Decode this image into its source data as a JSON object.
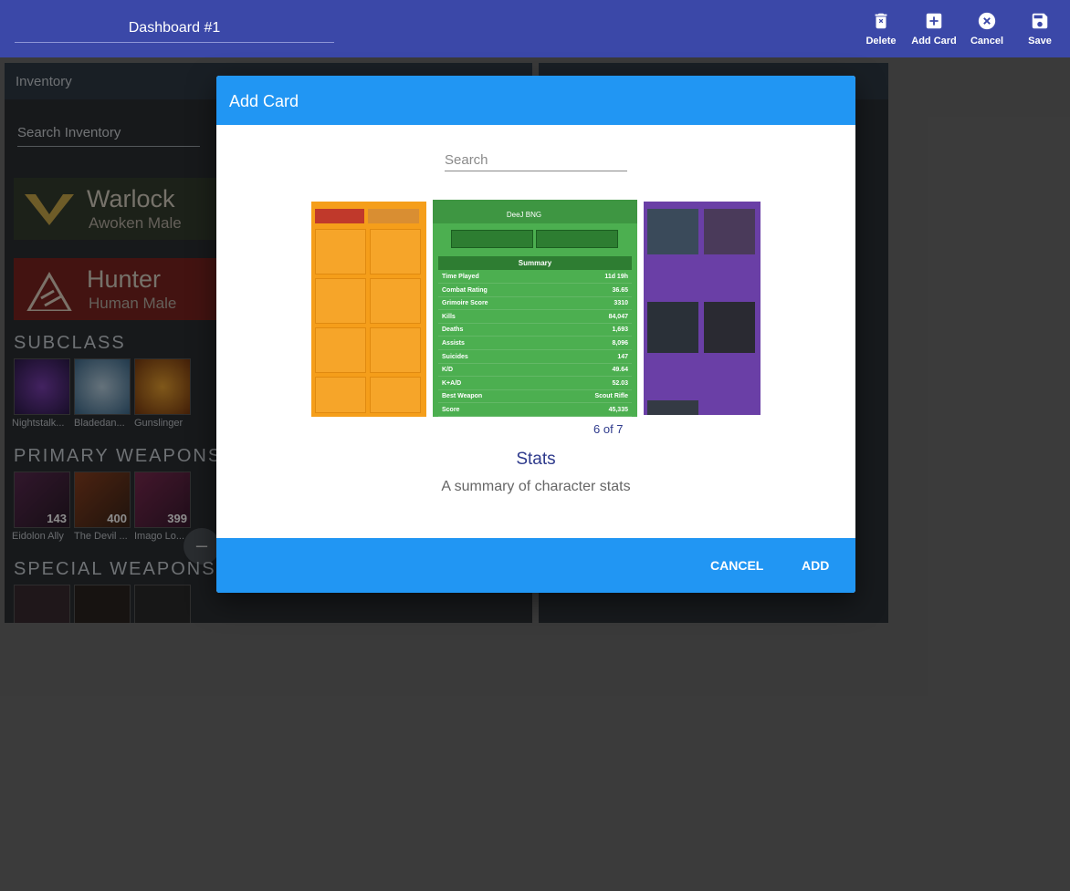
{
  "topbar": {
    "title": "Dashboard #1",
    "actions": [
      {
        "label": "Delete",
        "icon": "delete-icon"
      },
      {
        "label": "Add Card",
        "icon": "add-box-icon"
      },
      {
        "label": "Cancel",
        "icon": "cancel-circle-icon"
      },
      {
        "label": "Save",
        "icon": "floppy-disk-icon"
      }
    ],
    "color": "#3b48a8"
  },
  "inventory": {
    "title": "Inventory",
    "search_placeholder": "Search Inventory",
    "characters": [
      {
        "name": "Warlock",
        "subtitle": "Awoken Male"
      },
      {
        "name": "Hunter",
        "subtitle": "Human Male"
      }
    ],
    "sections": {
      "subclass": "SUBCLASS",
      "primary": "PRIMARY WEAPONS",
      "special": "SPECIAL WEAPONS"
    },
    "subclasses": [
      "Nightstalk...",
      "Bladedan...",
      "Gunslinger"
    ],
    "primary_weapons": [
      {
        "name": "Eidolon Ally",
        "value": "143"
      },
      {
        "name": "The Devil ...",
        "value": "400"
      },
      {
        "name": "Imago Lo...",
        "value": "399"
      }
    ]
  },
  "dialog": {
    "title": "Add Card",
    "search_placeholder": "Search",
    "pager": "6 of 7",
    "card_name": "Stats",
    "card_description": "A summary of character stats",
    "cancel_label": "CANCEL",
    "add_label": "ADD",
    "accent": "#2196f3"
  },
  "stats_preview": {
    "title": "DeeJ BNG",
    "summary_label": "Summary",
    "rows": [
      {
        "k": "Time Played",
        "v": "11d 19h"
      },
      {
        "k": "Combat Rating",
        "v": "36.65"
      },
      {
        "k": "Grimoire Score",
        "v": "3310"
      },
      {
        "k": "Kills",
        "v": "84,047"
      },
      {
        "k": "Deaths",
        "v": "1,693"
      },
      {
        "k": "Assists",
        "v": "8,096"
      },
      {
        "k": "Suicides",
        "v": "147"
      },
      {
        "k": "K/D",
        "v": "49.64"
      },
      {
        "k": "K+A/D",
        "v": "52.03"
      },
      {
        "k": "Best Weapon",
        "v": "Scout Rifle"
      },
      {
        "k": "Score",
        "v": "45,335"
      }
    ]
  }
}
